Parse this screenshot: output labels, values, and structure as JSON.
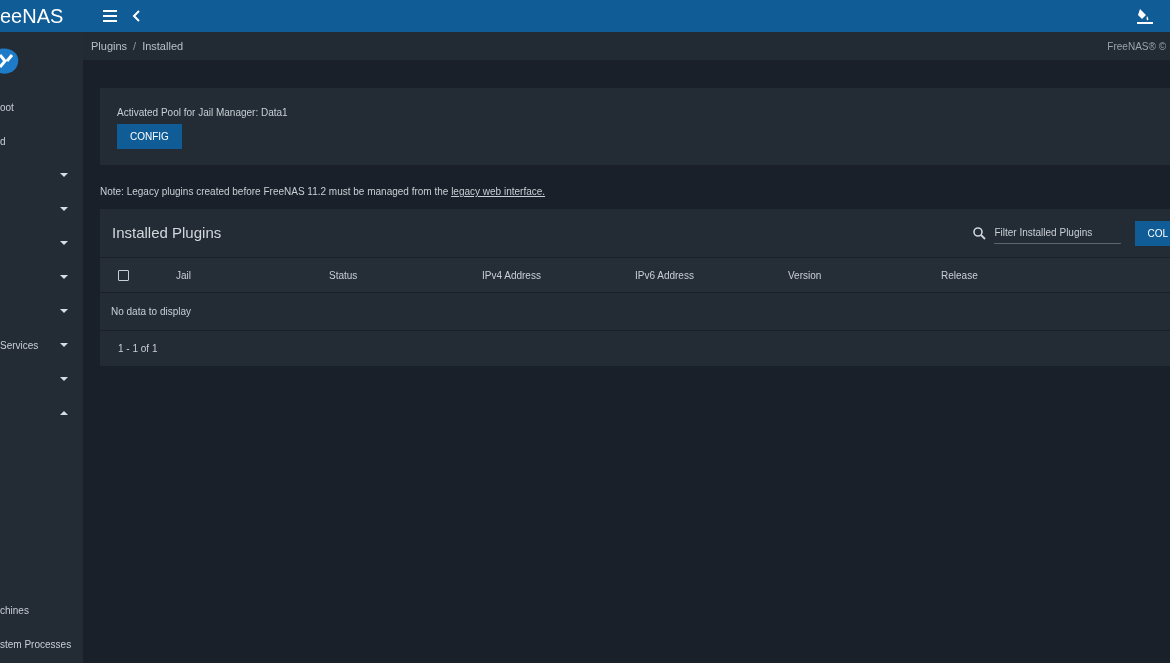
{
  "app_logo": "eeNAS",
  "breadcrumb": [
    "Plugins",
    "Installed"
  ],
  "breadcrumb_separator": "/",
  "copyright": "FreeNAS® ©",
  "sidebar": {
    "items": [
      {
        "label": "oot",
        "kind": "link"
      },
      {
        "label": "d",
        "kind": "link"
      },
      {
        "kind": "menu",
        "expanded": false
      },
      {
        "kind": "menu",
        "expanded": false
      },
      {
        "kind": "menu",
        "expanded": false
      },
      {
        "kind": "menu",
        "expanded": false
      },
      {
        "kind": "menu",
        "expanded": false
      },
      {
        "label": "Services",
        "kind": "menu",
        "expanded": false
      },
      {
        "kind": "menu",
        "expanded": false
      },
      {
        "kind": "menu",
        "expanded": true
      }
    ],
    "bottom_items": [
      {
        "label": "chines"
      },
      {
        "label": "stem Processes"
      }
    ]
  },
  "pool_card": {
    "text": "Activated Pool for Jail Manager: Data1",
    "button": "CONFIG"
  },
  "note": {
    "text": "Note: Legacy plugins created before FreeNAS 11.2 must be managed from the ",
    "link": "legacy web interface."
  },
  "table": {
    "title": "Installed Plugins",
    "filter_placeholder": "Filter Installed Plugins",
    "columns_button": "COL",
    "select_all_checked": false,
    "columns": [
      "Jail",
      "Status",
      "IPv4 Address",
      "IPv6 Address",
      "Version",
      "Release"
    ],
    "empty_text": "No data to display",
    "pagination": "1 - 1 of 1"
  }
}
